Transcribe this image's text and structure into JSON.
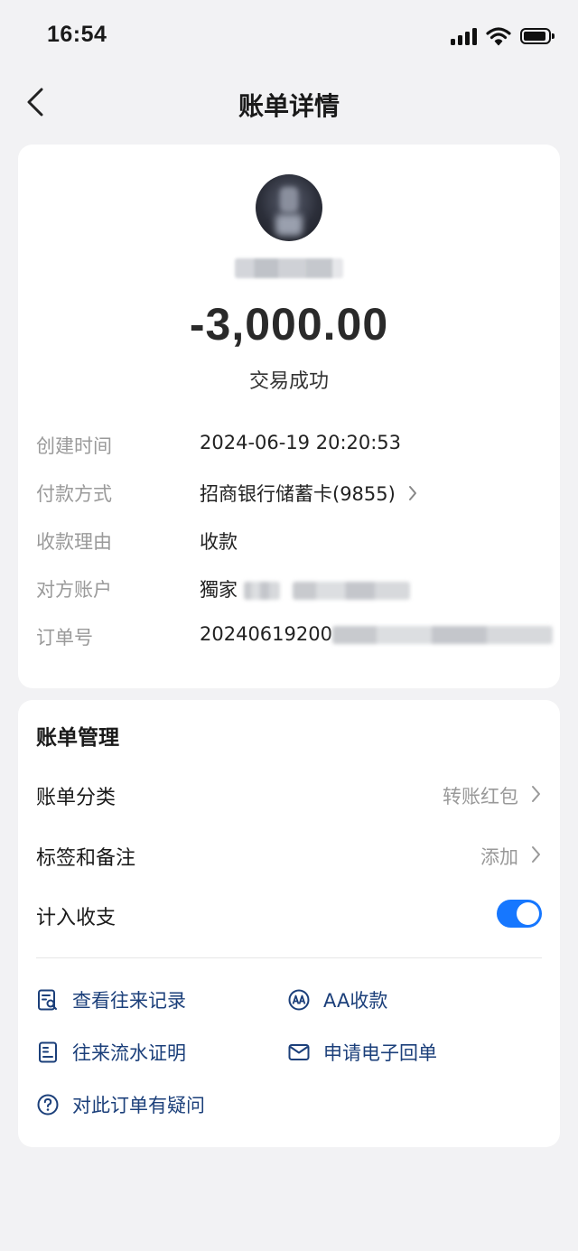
{
  "status_bar": {
    "time": "16:54"
  },
  "nav": {
    "title": "账单详情"
  },
  "transaction": {
    "amount": "-3,000.00",
    "status": "交易成功",
    "details": [
      {
        "label": "创建时间",
        "value": "2024-06-19 20:20:53"
      },
      {
        "label": "付款方式",
        "value": "招商银行储蓄卡(9855)"
      },
      {
        "label": "收款理由",
        "value": "收款"
      },
      {
        "label": "对方账户",
        "value": "獨家"
      },
      {
        "label": "订单号",
        "value": "20240619200"
      }
    ]
  },
  "management": {
    "title": "账单管理",
    "category": {
      "label": "账单分类",
      "value": "转账红包"
    },
    "tags": {
      "label": "标签和备注",
      "value": "添加"
    },
    "include": {
      "label": "计入收支",
      "enabled": true
    },
    "actions": {
      "records": "查看往来记录",
      "aa": "AA收款",
      "statement": "往来流水证明",
      "receipt": "申请电子回单",
      "question": "对此订单有疑问"
    }
  },
  "colors": {
    "accent": "#1677ff",
    "link": "#1b3f7a",
    "background": "#f2f2f4"
  }
}
